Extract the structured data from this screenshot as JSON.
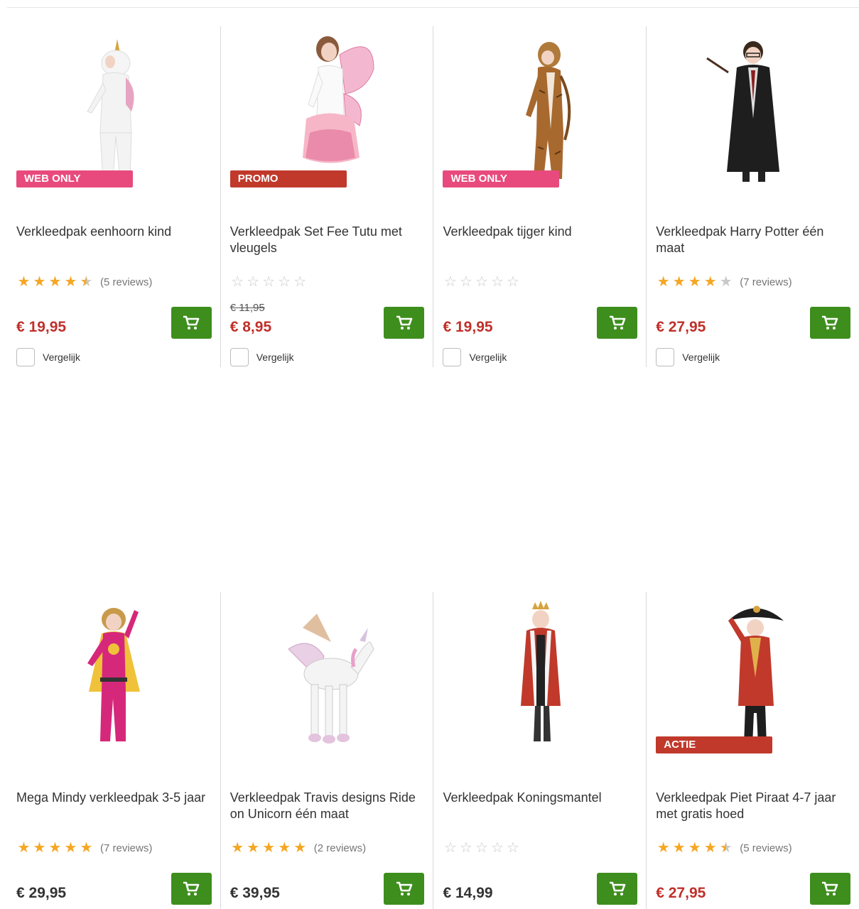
{
  "products": [
    {
      "title": "Verkleedpak eenhoorn kind",
      "badge": "WEB ONLY",
      "badge_color": "#e84a7d",
      "rating": 4.5,
      "reviews": "(5 reviews)",
      "old_price": "",
      "price": "€ 19,95",
      "compare_label": "Vergelijk",
      "image": "unicorn-costume"
    },
    {
      "title": "Verkleedpak Set Fee Tutu met vleugels",
      "badge": "PROMO",
      "badge_color": "#c0392b",
      "rating": 0,
      "reviews": "",
      "old_price": "€ 11,95",
      "price": "€ 8,95",
      "compare_label": "Vergelijk",
      "image": "fairy-costume"
    },
    {
      "title": "Verkleedpak tijger kind",
      "badge": "WEB ONLY",
      "badge_color": "#e84a7d",
      "rating": 0,
      "reviews": "",
      "old_price": "",
      "price": "€ 19,95",
      "compare_label": "Vergelijk",
      "image": "tiger-costume"
    },
    {
      "title": "Verkleedpak Harry Potter één maat",
      "badge": "",
      "rating": 4,
      "reviews": "(7 reviews)",
      "old_price": "",
      "price": "€ 27,95",
      "compare_label": "Vergelijk",
      "image": "wizard-robe"
    },
    {
      "title": "Mega Mindy verkleedpak 3-5 jaar",
      "badge": "",
      "rating": 5,
      "reviews": "(7 reviews)",
      "old_price": "",
      "price": "€ 29,95",
      "image": "superhero-costume"
    },
    {
      "title": "Verkleedpak Travis designs Ride on Unicorn één maat",
      "badge": "",
      "rating": 5,
      "reviews": "(2 reviews)",
      "old_price": "",
      "price": "€ 39,95",
      "image": "ride-on-unicorn"
    },
    {
      "title": "Verkleedpak Koningsmantel",
      "badge": "",
      "rating": 0,
      "reviews": "",
      "old_price": "",
      "price": "€ 14,99",
      "image": "king-cape"
    },
    {
      "title": "Verkleedpak Piet Piraat 4-7 jaar met gratis hoed",
      "badge": "ACTIE",
      "badge_color": "#c0392b",
      "rating": 4.5,
      "reviews": "(5 reviews)",
      "old_price": "",
      "price": "€ 27,95",
      "image": "pirate-costume"
    }
  ],
  "colors": {
    "price_red": "#c0302a",
    "cart_green": "#3e8e1d",
    "star_gold": "#f5a623"
  },
  "icons": {
    "cart": "cart-icon",
    "star": "star-icon"
  }
}
